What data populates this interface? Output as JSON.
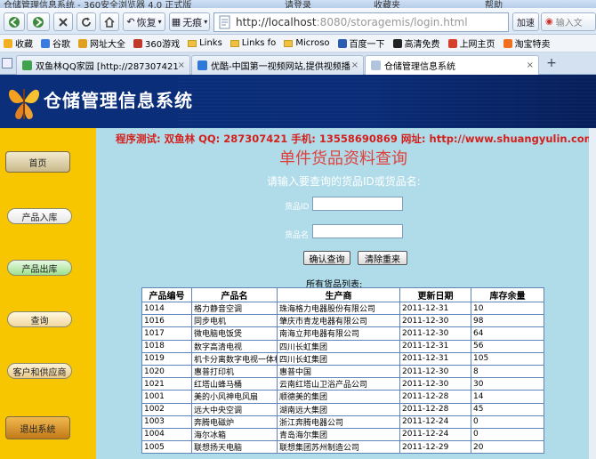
{
  "browser": {
    "window_title": "仓储管理信息系统 - 360安全浏览器 4.0 正式版",
    "title_right": [
      "请登录",
      "收藏夹",
      "帮助"
    ],
    "nav": {
      "back": "",
      "forward": "",
      "stop": "",
      "refresh": "",
      "home": "",
      "restore_label": "恢复",
      "notrace_label": "无痕",
      "address_host": "http://localhost",
      "address_rest": ":8080/storagemis/login.html",
      "accelerate_label": "加速",
      "search_placeholder": "输入文"
    },
    "bookmarks": [
      {
        "label": "收藏",
        "icon": "star-icon",
        "color": "#f0b020"
      },
      {
        "label": "谷歌",
        "icon": "google-icon",
        "color": "#3b7be0"
      },
      {
        "label": "网址大全",
        "icon": "nav-icon",
        "color": "#e0a020"
      },
      {
        "label": "360游戏",
        "icon": "game-icon",
        "color": "#c0392b"
      },
      {
        "label": "Links",
        "icon": "folder-icon",
        "color": "#f0c040"
      },
      {
        "label": "Links fo",
        "icon": "folder-icon",
        "color": "#f0c040"
      },
      {
        "label": "Microso",
        "icon": "folder-icon",
        "color": "#f0c040"
      },
      {
        "label": "百度一下",
        "icon": "baidu-icon",
        "color": "#2a5db0"
      },
      {
        "label": "高清免费",
        "icon": "m-icon",
        "color": "#222222"
      },
      {
        "label": "上网主页",
        "icon": "ie-icon",
        "color": "#d4402c"
      },
      {
        "label": "淘宝特卖",
        "icon": "taobao-icon",
        "color": "#f07020"
      }
    ],
    "tabs": [
      {
        "label": "双鱼林QQ家园 [http://287307421.q...",
        "icon_color": "#3fa34d",
        "active": false
      },
      {
        "label": "优酷-中国第一视频网站,提供视频播...",
        "icon_color": "#2d78d8",
        "active": false
      },
      {
        "label": "仓储管理信息系统",
        "icon_color": "#b0c4de",
        "active": true
      }
    ]
  },
  "page": {
    "system_title": "仓储管理信息系统",
    "sidebar": [
      {
        "label": "首页",
        "name": "sidebar-home"
      },
      {
        "label": "产品入库",
        "name": "sidebar-product-in"
      },
      {
        "label": "产品出库",
        "name": "sidebar-product-out"
      },
      {
        "label": "查询",
        "name": "sidebar-query"
      },
      {
        "label": "客户和供应商",
        "name": "sidebar-customers-suppliers"
      },
      {
        "label": "退出系统",
        "name": "sidebar-logout"
      }
    ],
    "contact": "程序测试: 双鱼林  QQ: 287307421  手机: 13558690869  网址: http://www.shuangyulin.com",
    "query_title": "单件货品资料查询",
    "prompt": "请输入要查询的货品ID或货品名:",
    "id_label": "货品ID",
    "name_label": "货品名",
    "id_value": "",
    "name_value": "",
    "confirm_button": "确认查询",
    "clear_button": "清除重来",
    "list_caption": "所有货品列表:",
    "table": {
      "headers": [
        "产品编号",
        "产品名",
        "生产商",
        "更新日期",
        "库存余量"
      ],
      "rows": [
        [
          "1014",
          "格力静音空调",
          "珠海格力电器股份有限公司",
          "2011-12-31",
          "10"
        ],
        [
          "1016",
          "同步电机",
          "肇庆市青龙电器有限公司",
          "2011-12-30",
          "98"
        ],
        [
          "1017",
          "微电脑电饭煲",
          "南海立邦电器有限公司",
          "2011-12-30",
          "64"
        ],
        [
          "1018",
          "数字高清电视",
          "四川长虹集团",
          "2011-12-31",
          "56"
        ],
        [
          "1019",
          "机卡分离数字电视一体机",
          "四川长虹集团",
          "2011-12-31",
          "105"
        ],
        [
          "1020",
          "惠普打印机",
          "惠普中国",
          "2011-12-30",
          "8"
        ],
        [
          "1021",
          "红塔山蜂马桶",
          "云南红塔山卫浴产品公司",
          "2011-12-30",
          "30"
        ],
        [
          "1001",
          "美的小风神电风扇",
          "顺德美的集团",
          "2011-12-28",
          "14"
        ],
        [
          "1002",
          "远大中央空调",
          "湖南远大集团",
          "2011-12-28",
          "45"
        ],
        [
          "1003",
          "奔腾电磁炉",
          "浙江奔腾电器公司",
          "2011-12-24",
          "0"
        ],
        [
          "1004",
          "海尔冰箱",
          "青岛海尔集团",
          "2011-12-24",
          "0"
        ],
        [
          "1005",
          "联想扬天电脑",
          "联想集团苏州制造公司",
          "2011-12-29",
          "20"
        ]
      ]
    }
  }
}
